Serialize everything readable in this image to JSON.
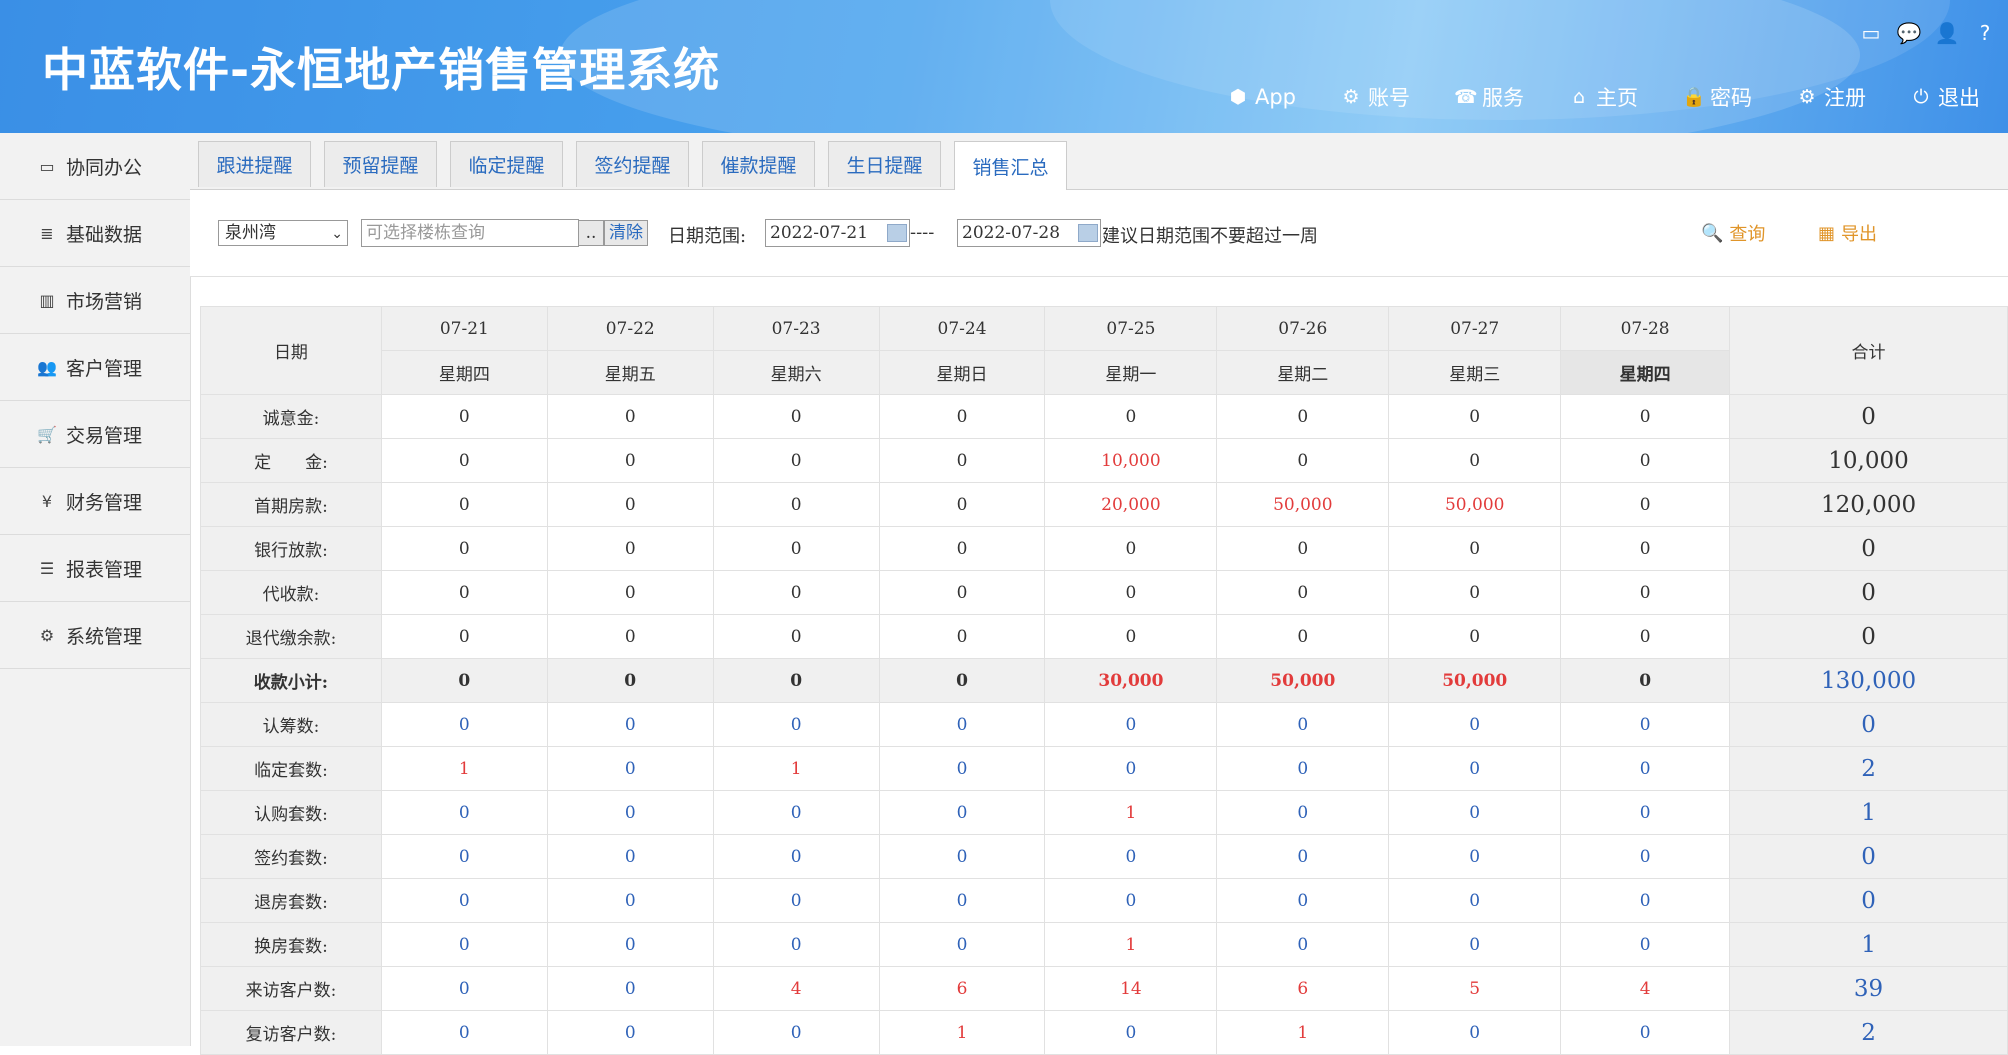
{
  "header": {
    "title": "中蓝软件-永恒地产销售管理系统",
    "top_icons": [
      "monitor-icon",
      "chat-icon",
      "user-icon",
      "help-icon"
    ],
    "nav": [
      {
        "label": "App",
        "icon": "cube-icon"
      },
      {
        "label": "账号",
        "icon": "cogs-icon"
      },
      {
        "label": "服务",
        "icon": "phone-icon"
      },
      {
        "label": "主页",
        "icon": "home-icon"
      },
      {
        "label": "密码",
        "icon": "lock-icon"
      },
      {
        "label": "注册",
        "icon": "gear-icon"
      },
      {
        "label": "退出",
        "icon": "power-icon"
      }
    ]
  },
  "sidebar": {
    "items": [
      {
        "label": "协同办公",
        "icon": "laptop-icon"
      },
      {
        "label": "基础数据",
        "icon": "database-icon"
      },
      {
        "label": "市场营销",
        "icon": "bar-chart-icon"
      },
      {
        "label": "客户管理",
        "icon": "users-icon"
      },
      {
        "label": "交易管理",
        "icon": "cart-icon"
      },
      {
        "label": "财务管理",
        "icon": "yen-icon"
      },
      {
        "label": "报表管理",
        "icon": "list-icon"
      },
      {
        "label": "系统管理",
        "icon": "cogs-icon"
      }
    ]
  },
  "tabs": [
    {
      "label": "跟进提醒"
    },
    {
      "label": "预留提醒"
    },
    {
      "label": "临定提醒"
    },
    {
      "label": "签约提醒"
    },
    {
      "label": "催款提醒"
    },
    {
      "label": "生日提醒"
    },
    {
      "label": "销售汇总",
      "active": true
    }
  ],
  "filter": {
    "project_select": "泉州湾",
    "building_placeholder": "可选择楼栋查询",
    "dots_button": "..",
    "clear_button": "清除",
    "date_range_label": "日期范围:",
    "date_from": "2022-07-21",
    "separator": "----",
    "date_to": "2022-07-28",
    "hint": "建议日期范围不要超过一周",
    "query_button": "查询",
    "export_button": "导出"
  },
  "table": {
    "date_header": "日期",
    "total_header": "合计",
    "dates": [
      "07-21",
      "07-22",
      "07-23",
      "07-24",
      "07-25",
      "07-26",
      "07-27",
      "07-28"
    ],
    "weekdays": [
      "星期四",
      "星期五",
      "星期六",
      "星期日",
      "星期一",
      "星期二",
      "星期三",
      "星期四"
    ],
    "rows": [
      {
        "label": "诚意金:",
        "values": [
          "0",
          "0",
          "0",
          "0",
          "0",
          "0",
          "0",
          "0"
        ],
        "total": "0",
        "kind": "money"
      },
      {
        "label": "定　　金:",
        "values": [
          "0",
          "0",
          "0",
          "0",
          "10,000",
          "0",
          "0",
          "0"
        ],
        "total": "10,000",
        "kind": "money"
      },
      {
        "label": "首期房款:",
        "values": [
          "0",
          "0",
          "0",
          "0",
          "20,000",
          "50,000",
          "50,000",
          "0"
        ],
        "total": "120,000",
        "kind": "money"
      },
      {
        "label": "银行放款:",
        "values": [
          "0",
          "0",
          "0",
          "0",
          "0",
          "0",
          "0",
          "0"
        ],
        "total": "0",
        "kind": "money"
      },
      {
        "label": "代收款:",
        "values": [
          "0",
          "0",
          "0",
          "0",
          "0",
          "0",
          "0",
          "0"
        ],
        "total": "0",
        "kind": "money"
      },
      {
        "label": "退代缴余款:",
        "values": [
          "0",
          "0",
          "0",
          "0",
          "0",
          "0",
          "0",
          "0"
        ],
        "total": "0",
        "kind": "money"
      },
      {
        "label": "收款小计:",
        "values": [
          "0",
          "0",
          "0",
          "0",
          "30,000",
          "50,000",
          "50,000",
          "0"
        ],
        "total": "130,000",
        "kind": "subtotal"
      },
      {
        "label": "认筹数:",
        "values": [
          "0",
          "0",
          "0",
          "0",
          "0",
          "0",
          "0",
          "0"
        ],
        "total": "0",
        "kind": "count"
      },
      {
        "label": "临定套数:",
        "values": [
          "1",
          "0",
          "1",
          "0",
          "0",
          "0",
          "0",
          "0"
        ],
        "total": "2",
        "kind": "count"
      },
      {
        "label": "认购套数:",
        "values": [
          "0",
          "0",
          "0",
          "0",
          "1",
          "0",
          "0",
          "0"
        ],
        "total": "1",
        "kind": "count"
      },
      {
        "label": "签约套数:",
        "values": [
          "0",
          "0",
          "0",
          "0",
          "0",
          "0",
          "0",
          "0"
        ],
        "total": "0",
        "kind": "count"
      },
      {
        "label": "退房套数:",
        "values": [
          "0",
          "0",
          "0",
          "0",
          "0",
          "0",
          "0",
          "0"
        ],
        "total": "0",
        "kind": "count"
      },
      {
        "label": "换房套数:",
        "values": [
          "0",
          "0",
          "0",
          "0",
          "1",
          "0",
          "0",
          "0"
        ],
        "total": "1",
        "kind": "count"
      },
      {
        "label": "来访客户数:",
        "values": [
          "0",
          "0",
          "4",
          "6",
          "14",
          "6",
          "5",
          "4"
        ],
        "total": "39",
        "kind": "count"
      },
      {
        "label": "复访客户数:",
        "values": [
          "0",
          "0",
          "0",
          "1",
          "0",
          "1",
          "0",
          "0"
        ],
        "total": "2",
        "kind": "count"
      }
    ]
  },
  "colors": {
    "accent": "#3a8fe6",
    "red": "#e23b3b",
    "blue": "#2f62b8",
    "orange": "#e0952a"
  }
}
